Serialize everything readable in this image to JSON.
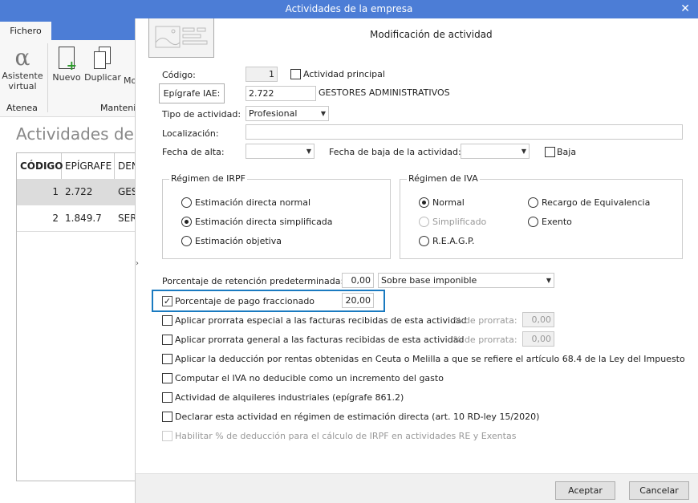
{
  "window": {
    "title": "Actividades de la empresa",
    "close": "✕"
  },
  "background": {
    "tab": "Fichero",
    "ribbon": {
      "asistente_line1": "Asistente",
      "asistente_line2": "virtual",
      "group_atenea": "Atenea",
      "nuevo": "Nuevo",
      "duplicar": "Duplicar",
      "modificar_partial": "Mo",
      "group_mant": "Manteni"
    },
    "page_title": "Actividades de la",
    "table": {
      "headers": [
        "CÓDIGO",
        "EPÍGRAFE",
        "DEN"
      ],
      "rows": [
        {
          "codigo": "1",
          "epigrafe": "2.722",
          "den": "GES"
        },
        {
          "codigo": "2",
          "epigrafe": "1.849.7",
          "den": "SERV"
        }
      ]
    }
  },
  "dialog": {
    "title": "Modificación de actividad",
    "codigo_label": "Código:",
    "codigo": "1",
    "principal_label": "Actividad principal",
    "principal_checked": false,
    "epigrafe_button": "Epígrafe IAE:",
    "epigrafe": "2.722",
    "epigrafe_desc": "GESTORES ADMINISTRATIVOS",
    "tipo_label": "Tipo de actividad:",
    "tipo": "Profesional",
    "localizacion_label": "Localización:",
    "localizacion": "",
    "fecha_alta_label": "Fecha de alta:",
    "fecha_alta": "",
    "fecha_baja_label": "Fecha de baja de la actividad:",
    "fecha_baja": "",
    "baja_label": "Baja",
    "baja_checked": false,
    "irpf": {
      "title": "Régimen de IRPF",
      "options": [
        "Estimación directa normal",
        "Estimación directa simplificada",
        "Estimación objetiva"
      ],
      "selected": "Estimación directa simplificada"
    },
    "iva": {
      "title": "Régimen de IVA",
      "options": [
        "Normal",
        "Simplificado",
        "R.E.A.G.P.",
        "Recargo de Equivalencia",
        "Exento"
      ],
      "selected": "Normal",
      "disabled": [
        "Simplificado"
      ]
    },
    "retencion_label": "Porcentaje de retención predeterminada:",
    "retencion": "0,00",
    "retencion_base": "Sobre base imponible",
    "pago_label": "Porcentaje de pago fraccionado",
    "pago": "20,00",
    "pago_checked": true,
    "highlight_color": "#1a7ac0",
    "prorrata_especial": "Aplicar prorrata especial a las facturas recibidas de esta actividad",
    "prorrata_general": "Aplicar prorrata general a las facturas recibidas de esta actividad",
    "prorrata_label": "% de prorrata:",
    "prorrata_especial_value": "0,00",
    "prorrata_general_value": "0,00",
    "ceuta": "Aplicar la deducción por rentas obtenidas en Ceuta o Melilla a que se refiere el artículo 68.4 de la Ley del Impuesto",
    "computar_iva": "Computar el IVA no deducible como un incremento del gasto",
    "alquileres": "Actividad de alquileres industriales (epígrafe 861.2)",
    "declarar": "Declarar esta actividad en régimen de estimación directa (art. 10 RD-ley 15/2020)",
    "habilitar": "Habilitar % de deducción para el cálculo de IRPF en actividades RE y Exentas",
    "aceptar": "Aceptar",
    "cancelar": "Cancelar"
  }
}
